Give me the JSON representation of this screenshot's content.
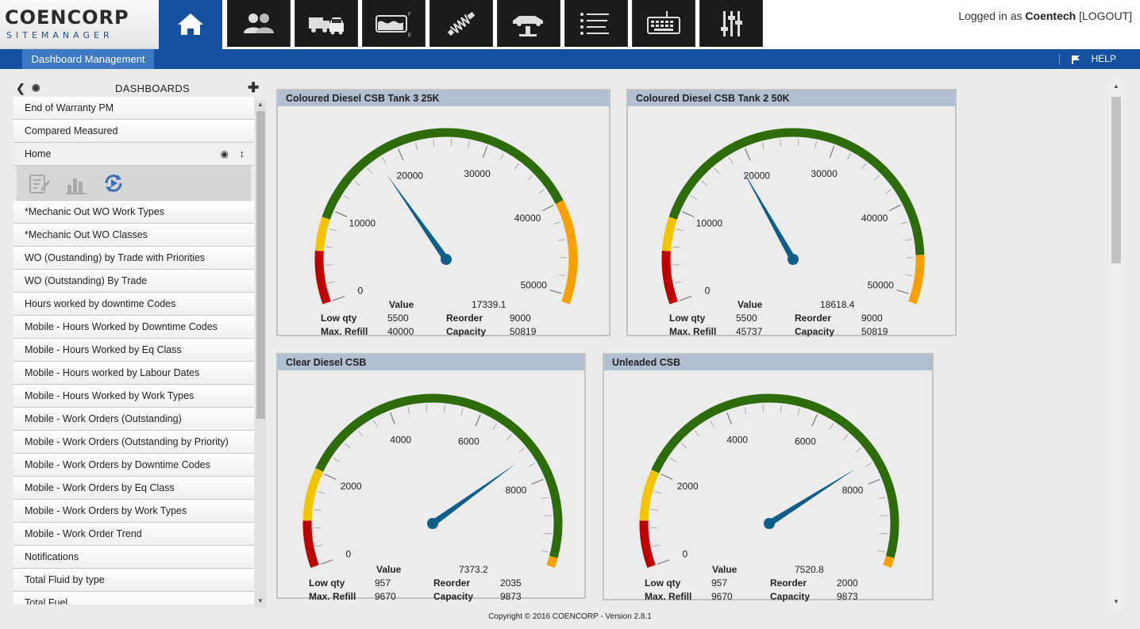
{
  "brand": {
    "name": "COENCORP",
    "sub": "SITEMANAGER"
  },
  "nav": [
    {
      "icon": "home-icon",
      "active": true
    },
    {
      "icon": "users-icon"
    },
    {
      "icon": "vehicles-icon"
    },
    {
      "icon": "fuel-tank-icon"
    },
    {
      "icon": "spring-icon"
    },
    {
      "icon": "car-lift-icon"
    },
    {
      "icon": "list-icon"
    },
    {
      "icon": "keyboard-icon"
    },
    {
      "icon": "sliders-icon"
    }
  ],
  "login": {
    "prefix": "Logged in as",
    "user": "Coentech",
    "logout": "[LOGOUT]"
  },
  "tabs": {
    "dashboard": "Dashboard Management",
    "help": "HELP"
  },
  "sidebar": {
    "title": "DASHBOARDS",
    "items": [
      "End of Warranty PM",
      "Compared Measured",
      "Home",
      "*Mechanic Out WO Work Types",
      "*Mechanic Out WO Classes",
      "WO (Oustanding) by Trade with Priorities",
      "WO (Outstanding) By Trade",
      "Hours worked by downtime Codes",
      "Mobile - Hours Worked by Downtime Codes",
      "Mobile - Hours Worked by Eq Class",
      "Mobile - Hours worked by Labour Dates",
      "Mobile - Hours Worked by Work Types",
      "Mobile - Work Orders (Outstanding)",
      "Mobile - Work Orders (Outstanding by Priority)",
      "Mobile - Work Orders by Downtime Codes",
      "Mobile - Work Orders by Eq Class",
      "Mobile - Work Orders by Work Types",
      "Mobile - Work Order Trend",
      "Notifications",
      "Total Fluid by type",
      "Total Fuel"
    ]
  },
  "labels": {
    "value": "Value",
    "low": "Low qty",
    "reorder": "Reorder",
    "maxrefill": "Max. Refill",
    "capacity": "Capacity"
  },
  "gauges": [
    {
      "title": "Coloured Diesel CSB Tank 3 25K",
      "value": "17339.1",
      "value_num": 17339.1,
      "low": "5500",
      "reorder": "9000",
      "maxrefill": "40000",
      "capacity": "50819",
      "max": 50819,
      "ticks": [
        0,
        10000,
        20000,
        30000,
        40000,
        50000
      ],
      "tick_labels": [
        "0",
        "10000",
        "20000",
        "30000",
        "40000",
        "50000"
      ],
      "bands": [
        {
          "from": 0,
          "to": 5500,
          "color": "#c00000"
        },
        {
          "from": 5500,
          "to": 9000,
          "color": "#f5c400"
        },
        {
          "from": 9000,
          "to": 40000,
          "color": "#2e6b0a"
        },
        {
          "from": 40000,
          "to": 50819,
          "color": "#f7a000"
        }
      ]
    },
    {
      "title": "Coloured Diesel CSB Tank 2 50K",
      "value": "18618.4",
      "value_num": 18618.4,
      "low": "5500",
      "reorder": "9000",
      "maxrefill": "45737",
      "capacity": "50819",
      "max": 50819,
      "ticks": [
        0,
        10000,
        20000,
        30000,
        40000,
        50000
      ],
      "tick_labels": [
        "0",
        "10000",
        "20000",
        "30000",
        "40000",
        "50000"
      ],
      "bands": [
        {
          "from": 0,
          "to": 5500,
          "color": "#c00000"
        },
        {
          "from": 5500,
          "to": 9000,
          "color": "#f5c400"
        },
        {
          "from": 9000,
          "to": 45737,
          "color": "#2e6b0a"
        },
        {
          "from": 45737,
          "to": 50819,
          "color": "#f7a000"
        }
      ]
    },
    {
      "title": "Clear Diesel CSB",
      "value": "7373.2",
      "value_num": 7373.2,
      "low": "957",
      "reorder": "2035",
      "maxrefill": "9670",
      "capacity": "9873",
      "max": 9873,
      "ticks": [
        0,
        2000,
        4000,
        6000,
        8000
      ],
      "tick_labels": [
        "0",
        "2000",
        "4000",
        "6000",
        "8000"
      ],
      "bands": [
        {
          "from": 0,
          "to": 957,
          "color": "#c00000"
        },
        {
          "from": 957,
          "to": 2035,
          "color": "#f5c400"
        },
        {
          "from": 2035,
          "to": 9670,
          "color": "#2e6b0a"
        },
        {
          "from": 9670,
          "to": 9873,
          "color": "#f7a000"
        }
      ]
    },
    {
      "title": "Unleaded CSB",
      "value": "7520.8",
      "value_num": 7520.8,
      "low": "957",
      "reorder": "2000",
      "maxrefill": "9670",
      "capacity": "9873",
      "max": 9873,
      "ticks": [
        0,
        2000,
        4000,
        6000,
        8000
      ],
      "tick_labels": [
        "0",
        "2000",
        "4000",
        "6000",
        "8000"
      ],
      "bands": [
        {
          "from": 0,
          "to": 957,
          "color": "#c00000"
        },
        {
          "from": 957,
          "to": 2000,
          "color": "#f5c400"
        },
        {
          "from": 2000,
          "to": 9670,
          "color": "#2e6b0a"
        },
        {
          "from": 9670,
          "to": 9873,
          "color": "#f7a000"
        }
      ]
    }
  ],
  "footer": "Copyright © 2016 COENCORP - Version 2.8.1"
}
